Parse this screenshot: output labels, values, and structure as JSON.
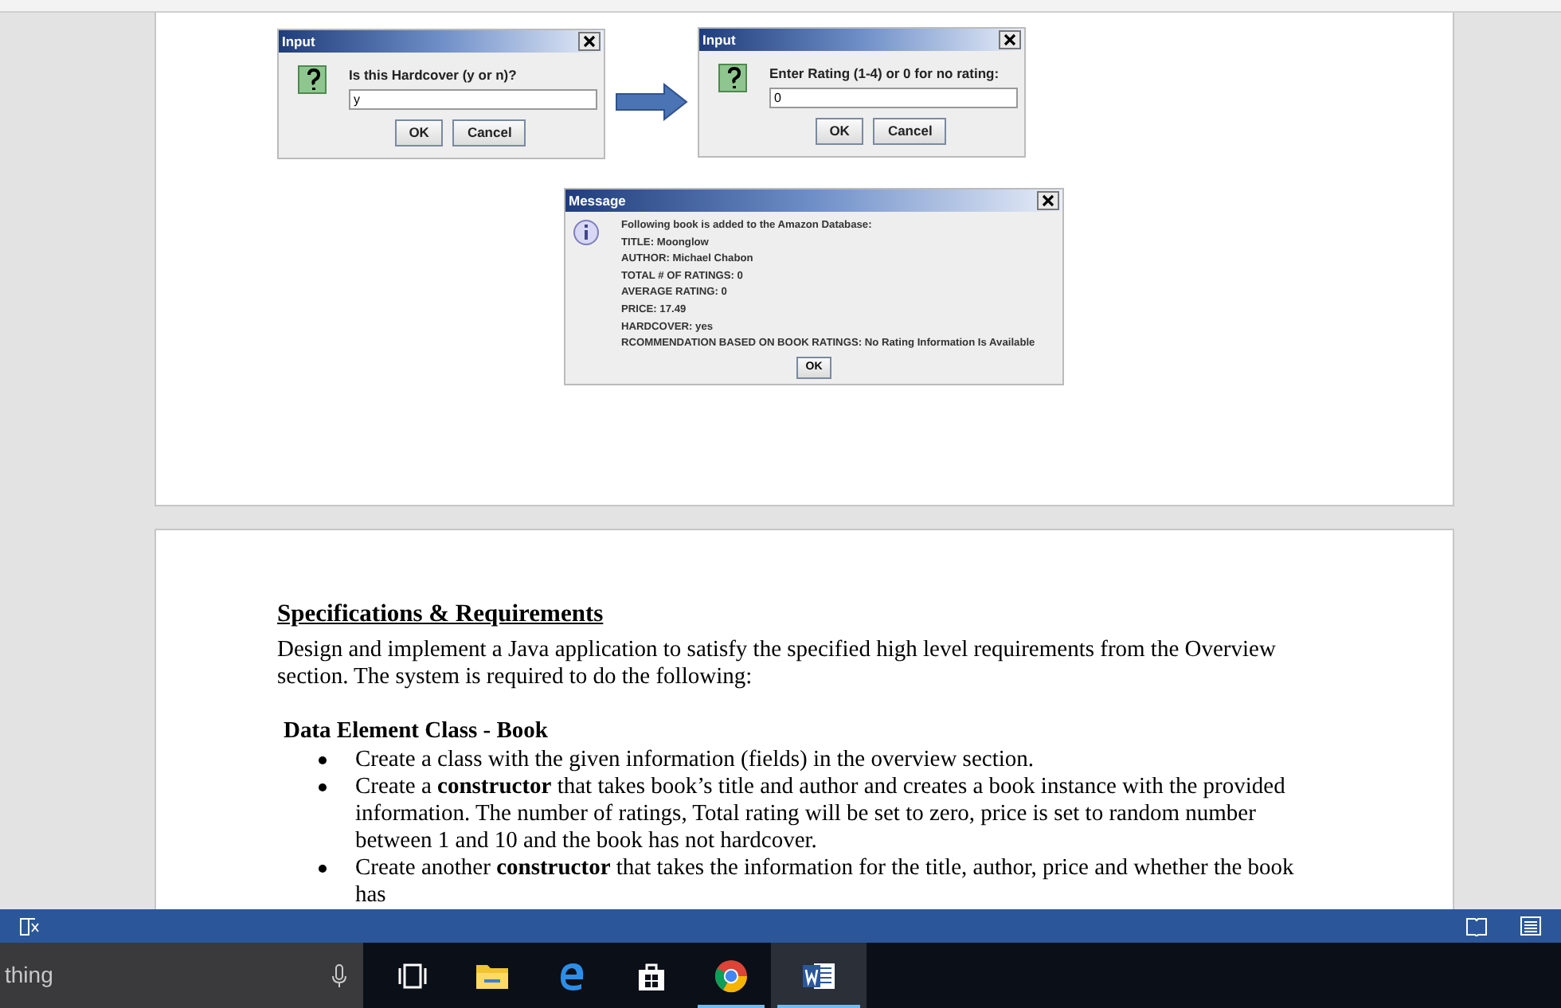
{
  "input_dialogs": [
    {
      "title": "Input",
      "prompt": "Is this Hardcover (y or n)?",
      "value": "y",
      "buttons": [
        "OK",
        "Cancel"
      ]
    },
    {
      "title": "Input",
      "prompt": "Enter Rating (1-4) or 0 for no rating:",
      "value": "0",
      "buttons": [
        "OK",
        "Cancel"
      ]
    }
  ],
  "message_dialog": {
    "title": "Message",
    "lines": [
      "Following book is added to the Amazon Database:",
      "TITLE:  Moonglow",
      "AUTHOR:  Michael Chabon",
      "TOTAL # OF RATINGS:  0",
      "AVERAGE RATING:  0",
      "PRICE:  17.49",
      "HARDCOVER:  yes",
      "RCOMMENDATION BASED ON BOOK RATINGS:  No Rating Information Is Available"
    ],
    "button": "OK"
  },
  "document": {
    "heading": "Specifications & Requirements",
    "intro": "Design and implement a Java application to satisfy the specified high level requirements from the Overview section.  The system is required to do the following:",
    "subheading": "Data Element Class - Book",
    "bullets": [
      "Create a class with the given information (fields) in the overview section.",
      "Create a **constructor** that takes book’s title and author and creates a book instance with the provided information. The number of ratings, Total rating will be set to zero, price is set to random number between 1 and 10 and the book has not hardcover.",
      "Create another **constructor** that takes the information for the title, author, price and whether the book has"
    ]
  },
  "taskbar": {
    "search_text": "thing",
    "apps": [
      {
        "kind": "task-view",
        "active": false
      },
      {
        "kind": "explorer",
        "active": false
      },
      {
        "kind": "edge",
        "active": false
      },
      {
        "kind": "store",
        "active": false
      },
      {
        "kind": "chrome",
        "active": true
      },
      {
        "kind": "word",
        "active": true
      }
    ]
  }
}
